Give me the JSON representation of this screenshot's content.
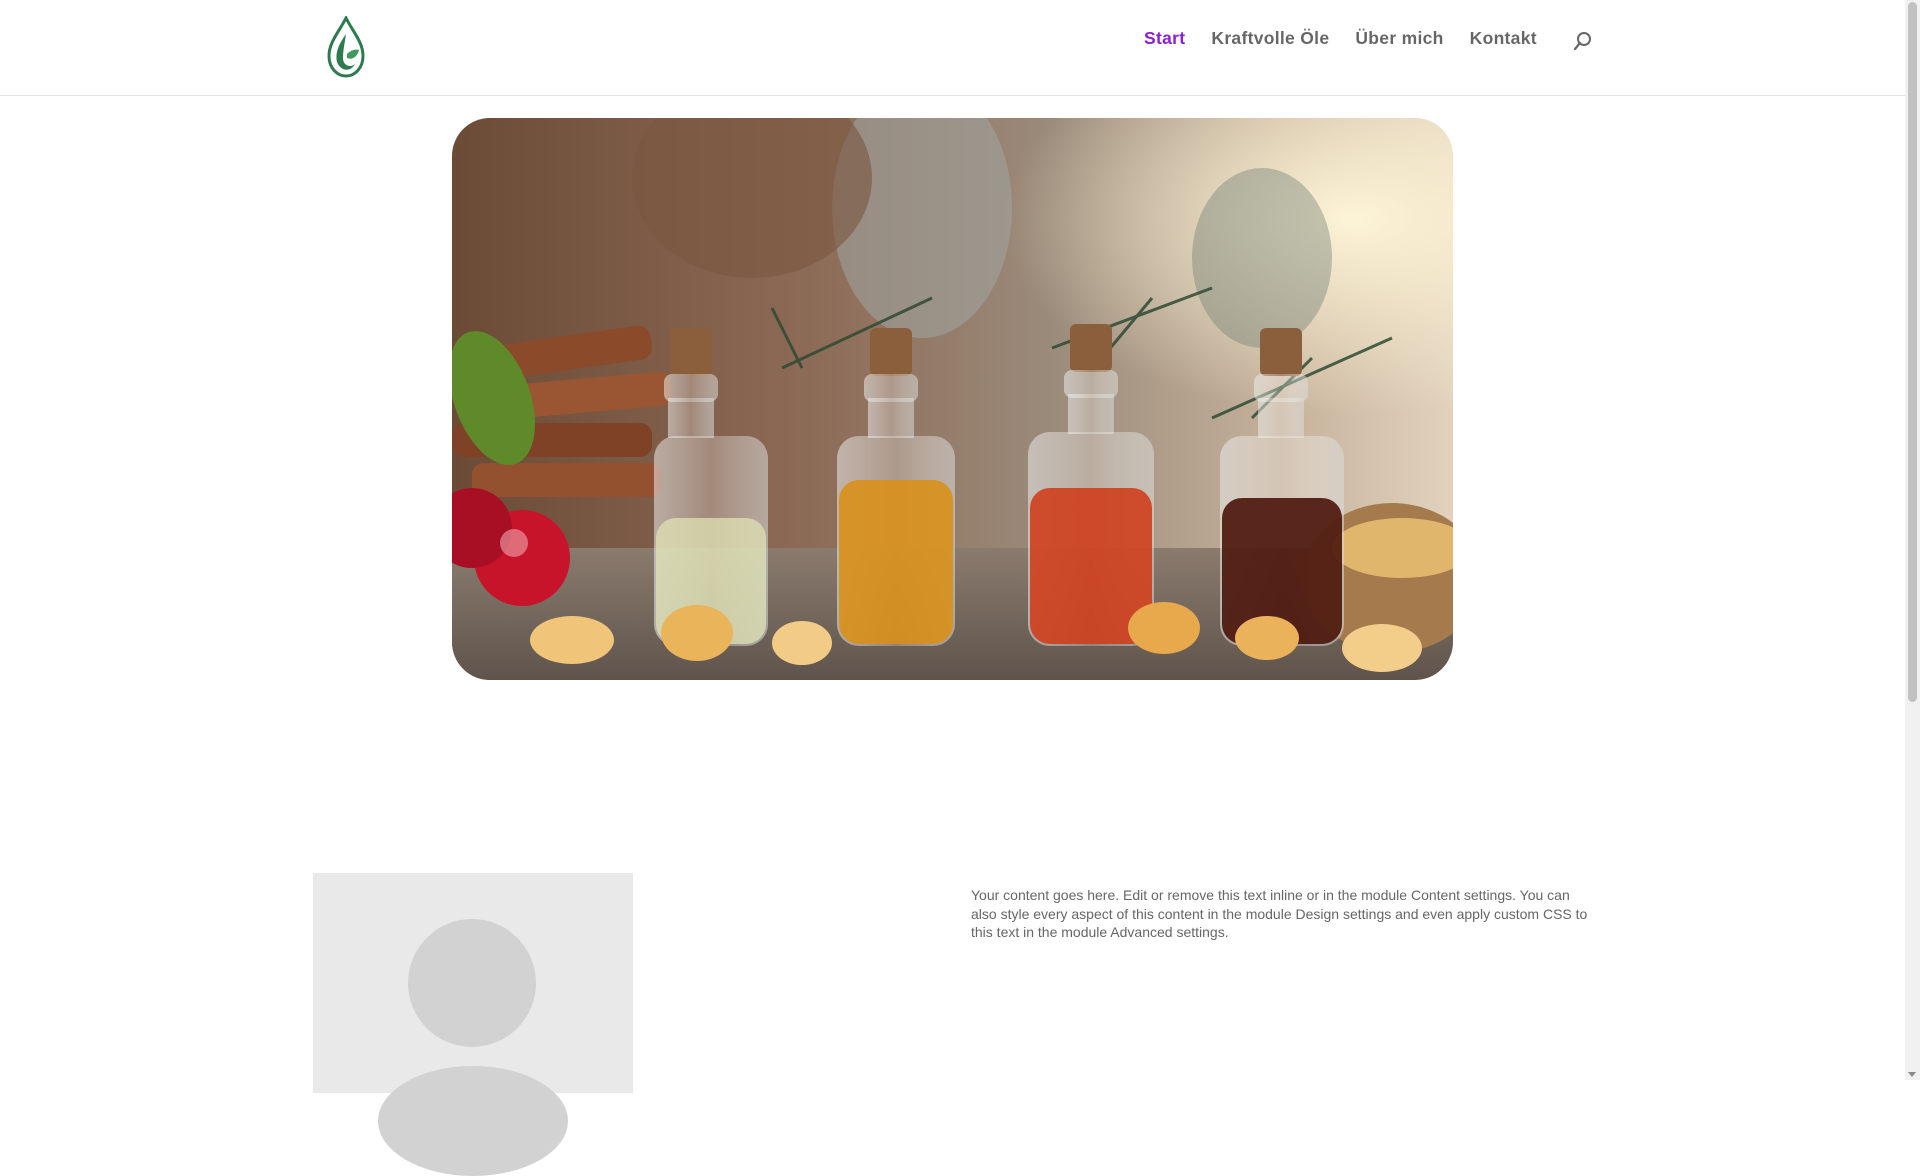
{
  "header": {
    "logo_icon": "oil-drop-leaf-logo",
    "nav": [
      {
        "label": "Start",
        "active": true
      },
      {
        "label": "Kraftvolle Öle",
        "active": false
      },
      {
        "label": "Über mich",
        "active": false
      },
      {
        "label": "Kontakt",
        "active": false
      }
    ],
    "search_icon": "search-icon"
  },
  "hero": {
    "image_subject": "four cork-stoppered glass bottles with essential oils, frankincense resin, cinnamon sticks, berries and pine branches"
  },
  "content": {
    "text": "Your content goes here. Edit or remove this text inline or in the module Content settings. You can also style every aspect of this content in the module Design settings and even apply custom CSS to this text in the module Advanced settings."
  },
  "colors": {
    "accent": "#8a1fd1",
    "nav_text": "#666666",
    "logo_green": "#2e7a4f",
    "placeholder_bg": "#e9e9e9"
  }
}
